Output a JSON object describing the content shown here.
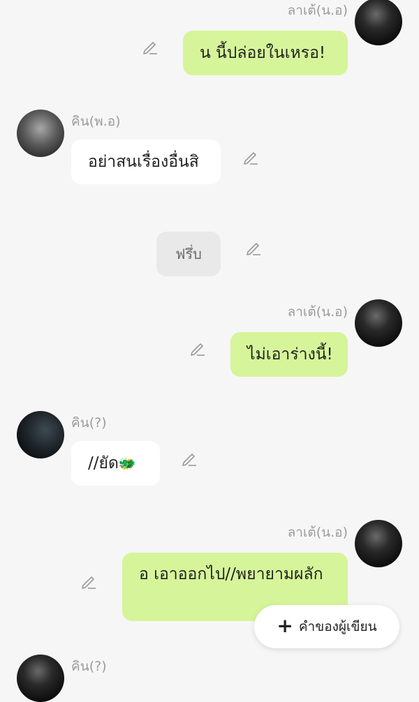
{
  "messages": [
    {
      "name": "ลาเต้(น.อ)",
      "text": "น  นี้ปล่อยในเหรอ!"
    },
    {
      "name": "คิน(พ.อ)",
      "text": "อย่าสนเรื่องอื่นสิ"
    },
    {
      "text": "ฟรึ่บ"
    },
    {
      "name": "ลาเต้(น.อ)",
      "text": "ไม่เอาร่างนี้!"
    },
    {
      "name": "คิน(?)",
      "text": "//ยัด",
      "emoji": "🐲"
    },
    {
      "name": "ลาเต้(น.อ)",
      "text": "อ  เอาออกไป//พยายามผลัก"
    },
    {
      "name": "คิน(?)"
    }
  ],
  "fab": {
    "label": "คำของผู้เขียน",
    "icon": "plus-icon"
  },
  "colors": {
    "green_bubble": "#d6f59a",
    "white_bubble": "#ffffff",
    "narration_bubble": "#e9e9e9",
    "background": "#f6f6f6"
  }
}
